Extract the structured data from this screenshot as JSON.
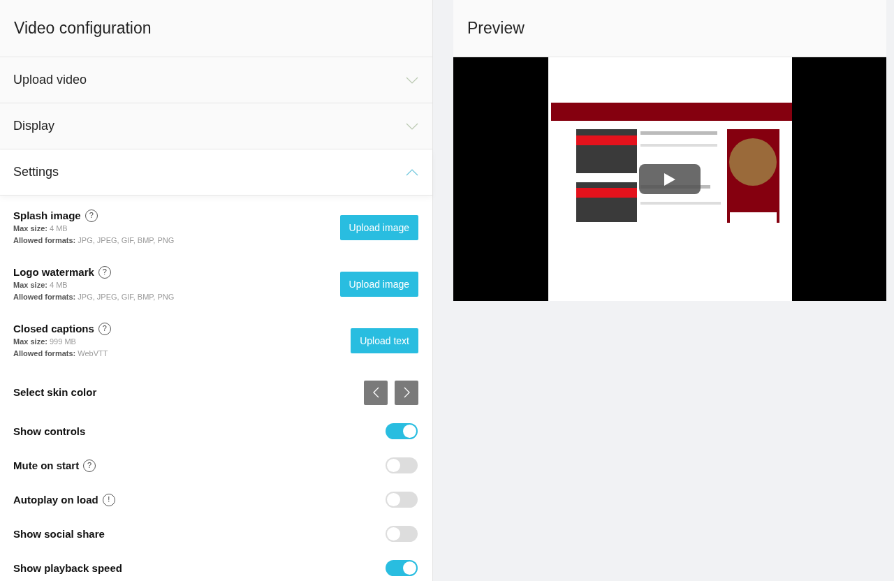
{
  "config": {
    "title": "Video configuration",
    "sections": [
      {
        "label": "Upload video",
        "expanded": false
      },
      {
        "label": "Display",
        "expanded": false
      },
      {
        "label": "Settings",
        "expanded": true
      }
    ],
    "settings": [
      {
        "kind": "upload",
        "label": "Splash image",
        "help": "?",
        "max_size_label": "Max size:",
        "max_size": "4 MB",
        "formats_label": "Allowed formats:",
        "formats": "JPG, JPEG, GIF, BMP, PNG",
        "button": "Upload image"
      },
      {
        "kind": "upload",
        "label": "Logo watermark",
        "help": "?",
        "max_size_label": "Max size:",
        "max_size": "4 MB",
        "formats_label": "Allowed formats:",
        "formats": "JPG, JPEG, GIF, BMP, PNG",
        "button": "Upload image"
      },
      {
        "kind": "upload",
        "label": "Closed captions",
        "help": "?",
        "max_size_label": "Max size:",
        "max_size": "999 MB",
        "formats_label": "Allowed formats:",
        "formats": "WebVTT",
        "button": "Upload text"
      },
      {
        "kind": "skin",
        "label": "Select skin color"
      },
      {
        "kind": "toggle",
        "label": "Show controls",
        "on": true
      },
      {
        "kind": "toggle",
        "label": "Mute on start",
        "help": "?",
        "on": false
      },
      {
        "kind": "toggle",
        "label": "Autoplay on load",
        "help": "!",
        "on": false
      },
      {
        "kind": "toggle",
        "label": "Show social share",
        "on": false
      },
      {
        "kind": "toggle",
        "label": "Show playback speed",
        "on": true
      }
    ]
  },
  "preview": {
    "title": "Preview"
  }
}
